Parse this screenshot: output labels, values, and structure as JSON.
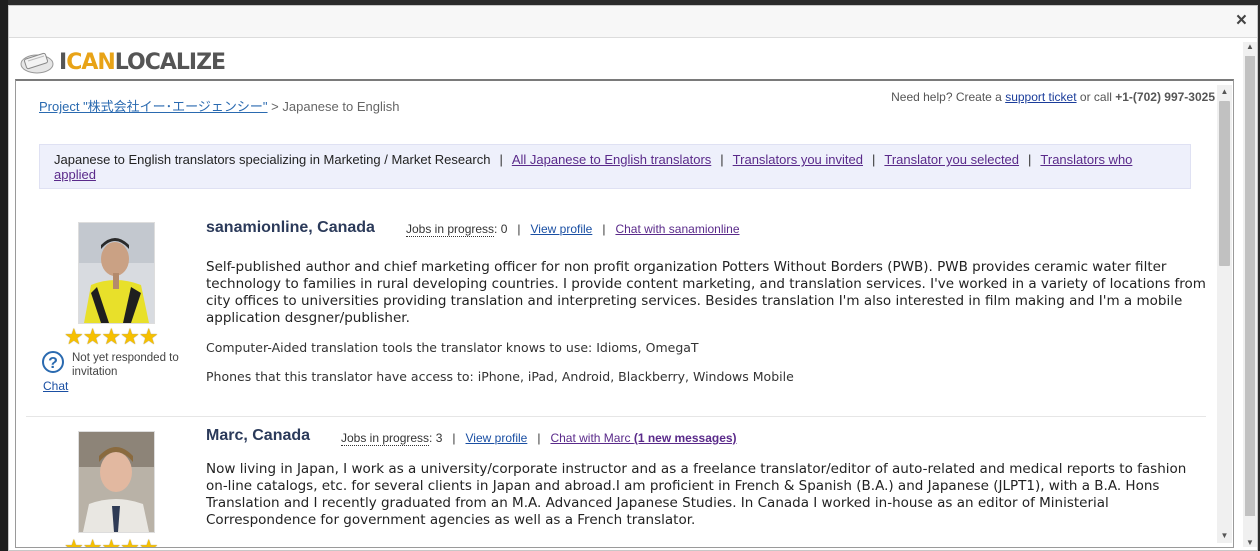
{
  "close_label": "×",
  "logo": {
    "part1": "I",
    "part2": "CAN",
    "part3": "LOCALIZE"
  },
  "breadcrumb": {
    "project_link": "Project \"株式会社イー･エージェンシー\"",
    "separator": " > ",
    "current": "Japanese to English"
  },
  "help": {
    "prefix": "Need help? Create a ",
    "link": "support ticket",
    "middle": " or call ",
    "phone": "+1-(702) 997-3025"
  },
  "tabs": {
    "current": "Japanese to English translators specializing in Marketing / Market Research",
    "sep": "|",
    "items": [
      "All Japanese to English translators",
      "Translators you invited",
      "Translator you selected",
      "Translators who applied"
    ]
  },
  "translators": [
    {
      "name": "sanamionline, Canada",
      "jobs_label": "Jobs in progress",
      "jobs_count": ": 0",
      "view_profile": "View profile",
      "chat": "Chat with sanamionline",
      "rating_stars": 5,
      "status": "Not yet responded to invitation",
      "status_chat": "Chat",
      "bio": "Self-published author and chief marketing officer for non profit organization Potters Without Borders (PWB). PWB provides ceramic water filter technology to families in rural developing countries. I provide content marketing, and translation services. I've worked in a variety of locations from city offices to universities providing translation and interpreting services. Besides translation I'm also interested in film making and I'm a mobile application desgner/publisher.",
      "tools": "Computer-Aided translation tools the translator knows to use: Idioms, OmegaT",
      "phones": "Phones that this translator have access to: iPhone, iPad, Android, Blackberry, Windows Mobile"
    },
    {
      "name": "Marc, Canada",
      "jobs_label": "Jobs in progress",
      "jobs_count": ": 3",
      "view_profile": "View profile",
      "chat": "Chat with Marc",
      "chat_new": "(1 new messages)",
      "rating_stars": 5,
      "bio": "Now living in Japan, I work as a university/corporate instructor and as a freelance translator/editor of auto-related and medical reports to fashion on-line catalogs, etc. for several clients in Japan and abroad.I am proficient in French & Spanish (B.A.) and Japanese (JLPT1), with a B.A. Hons Translation and I recently graduated from an M.A. Advanced Japanese Studies. In Canada I worked in-house as an editor of Ministerial Correspondence for government agencies as well as a French translator."
    }
  ],
  "stars_glyph": "★★★★★",
  "colors": {
    "brand_accent": "#e8a317",
    "star": "#f6c000",
    "link": "#1a4fa3",
    "visited_link": "#5a2a8a"
  }
}
